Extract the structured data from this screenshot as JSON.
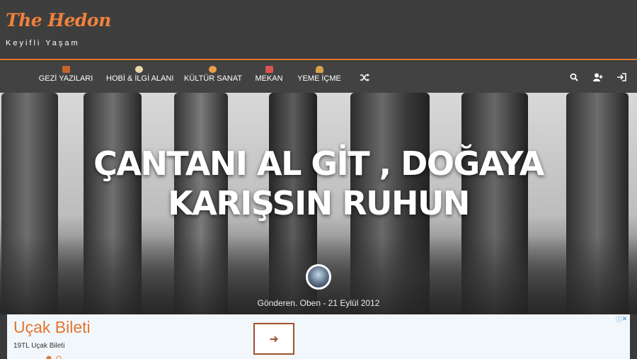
{
  "site": {
    "name": "The Hedon",
    "tagline": "Keyifli Yaşam"
  },
  "nav": {
    "items": [
      {
        "label": "GEZİ YAZILARI",
        "icon": "suitcase-icon",
        "color": "#c8632b"
      },
      {
        "label": "HOBİ & İLGİ ALANI",
        "icon": "palette-icon",
        "color": "#e9d8a6"
      },
      {
        "label": "KÜLTÜR SANAT",
        "icon": "masks-icon",
        "color": "#e8a04a"
      },
      {
        "label": "MEKAN",
        "icon": "calendar-icon",
        "color": "#d9534f"
      },
      {
        "label": "YEME İÇME",
        "icon": "burger-icon",
        "color": "#d8a24a"
      }
    ],
    "right_icons": [
      "search-icon",
      "user-plus-icon",
      "sign-in-icon"
    ]
  },
  "post": {
    "title": "ÇANTANI AL GİT , DOĞAYA KARIŞSIN RUHUN",
    "meta": "Gönderen. Oben - 21 Eylül 2012"
  },
  "ad": {
    "title": "Uçak Bileti",
    "subtitle": "19TL Uçak Bileti",
    "button_glyph": "➜"
  },
  "colors": {
    "accent": "#e5762f",
    "topbar": "#3e3e3e",
    "navbar": "#424242"
  }
}
